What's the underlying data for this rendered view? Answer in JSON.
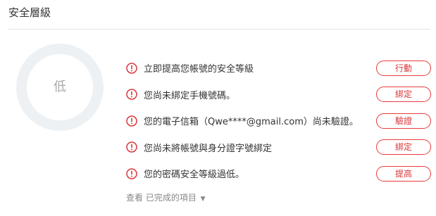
{
  "panel": {
    "title": "安全層級"
  },
  "level": {
    "label": "低"
  },
  "alerts": [
    {
      "text": "立即提高您帳號的安全等級",
      "button": "行動"
    },
    {
      "text": "您尚未綁定手機號碼。",
      "button": "綁定"
    },
    {
      "text": "您的電子信箱（Qwe****@gmail.com）尚未驗證。",
      "button": "驗證"
    },
    {
      "text": "您尚未將帳號與身分證字號綁定",
      "button": "綁定"
    },
    {
      "text": "您的密碼安全等級過低。",
      "button": "提高"
    }
  ],
  "completed": {
    "label": "查看 已完成的項目",
    "caret": "▼"
  },
  "colors": {
    "accent": "#e83a3a",
    "ring": "#edf1f4"
  },
  "icons": {
    "alert": "warning-circle-icon",
    "expand": "caret-down-icon"
  }
}
